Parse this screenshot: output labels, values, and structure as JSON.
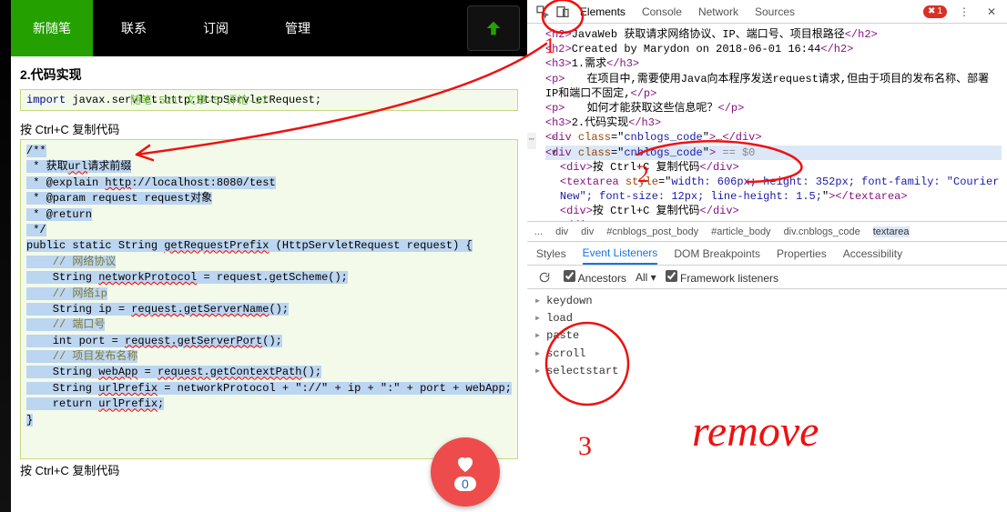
{
  "topbar": {
    "new_post": "新随笔",
    "contact": "联系",
    "subscribe": "订阅",
    "manage": "管理"
  },
  "stats": "随笔-521  文章-5  评论-17",
  "h2": "2.代码实现",
  "import_line_kw": "import",
  "import_line_rest": " javax.servlet.http.HttpServletRequest;",
  "copy_label": "按 Ctrl+C 复制代码",
  "copy_label_2": "按 Ctrl+C 复制代码",
  "code": {
    "l1": "/**",
    "l2_a": " * 获取",
    "l2_u": "url",
    "l2_b": "请求前缀",
    "l3_a": " * @explain ",
    "l3_u": "http",
    "l3_b": "://localhost:8080/test",
    "l4": " * @param request request对象",
    "l5": " * @return",
    "l6": " */",
    "l7_a": "public static String ",
    "l7_u": "getRequestPrefix",
    "l7_b": " (HttpServletRequest request) {",
    "l8": "    // 网络协议",
    "l9_a": "    String ",
    "l9_u": "networkProtocol",
    "l9_b": " = request.getScheme();",
    "l10": "    // 网络ip",
    "l11_a": "    String ip = ",
    "l11_u": "request.getServerName",
    "l11_b": "();",
    "l12": "    // 端口号",
    "l13_a": "    int port = ",
    "l13_u": "request.getServerPort",
    "l13_b": "();",
    "l14": "    // 项目发布名称",
    "l15_a": "    String ",
    "l15_u1": "webApp",
    "l15_b": " = ",
    "l15_u2": "request.getContextPath",
    "l15_c": "();",
    "l16_a": "    String ",
    "l16_u": "urlPrefix",
    "l16_b": " = networkProtocol + \"://\" + ip + \":\" + port + webApp;",
    "l17_a": "    return ",
    "l17_u": "urlPrefix",
    "l17_b": ";",
    "l18": "}"
  },
  "like_count": "0",
  "devtools": {
    "tabs": [
      "Elements",
      "Console",
      "Network",
      "Sources"
    ],
    "error_count": "1",
    "crumbs": [
      "...",
      "div",
      "div",
      "#cnblogs_post_body",
      "#article_body",
      "div.cnblogs_code",
      "textarea"
    ],
    "panel_tabs": [
      "Styles",
      "Event Listeners",
      "DOM Breakpoints",
      "Properties",
      "Accessibility"
    ],
    "ancestors": "Ancestors",
    "all": "All",
    "fw": "Framework listeners",
    "events": [
      "keydown",
      "load",
      "paste",
      "scroll",
      "selectstart"
    ]
  },
  "dom": {
    "h2_open": "<h2>",
    "h2_text": "JavaWeb 获取请求网络协议、IP、端口号、项目根路径",
    "h2_close": "</h2>",
    "h2b_open": "<h2>",
    "h2b_text": "Created by Marydon on 2018-06-01 16:44",
    "h2b_close": "</h2>",
    "h3a_open": "<h3>",
    "h3a_text": "1.需求",
    "h3a_close": "</h3>",
    "p1_open": "<p>",
    "p1_text": "　　在项目中,需要使用Java向本程序发送request请求,但由于项目的发布名称、部署IP和端口不固定,",
    "p1_close": "</p>",
    "p2_open": "<p>",
    "p2_text": "　　如何才能获取这些信息呢？",
    "p2_close": "</p>",
    "h3b_open": "<h3>",
    "h3b_text": "2.代码实现",
    "h3b_close": "</h3>",
    "div1": "<div class=\"cnblogs_code\">…</div>",
    "sel_line": "<div class=\"cnblogs_code\">",
    "sel_hint": " == $0",
    "d_copy1": "<div>按 Ctrl+C 复制代码</div>",
    "ta_open": "<textarea style=\"width: 606px; height: 352px; font-family: \"Courier New\"; font-size: 12px; line-height: 1.5;\">",
    "ta_close": "</textarea>",
    "d_copy2": "<div>按 Ctrl+C 复制代码</div>",
    "div_close": "</div>"
  }
}
